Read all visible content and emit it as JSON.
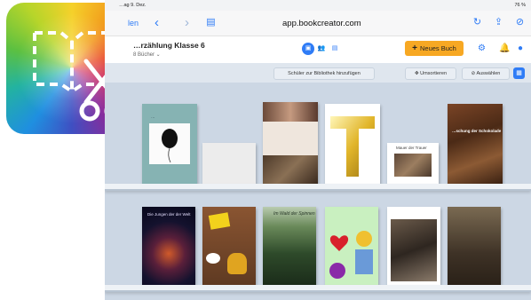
{
  "status": {
    "time": "…ag 9. Dez.",
    "battery": "76 %"
  },
  "browser": {
    "back_label": "len",
    "url": "app.bookcreator.com"
  },
  "app_header": {
    "library_title": "…rzählung Klasse 6",
    "library_subtitle": "8 Bücher ⌄",
    "new_book_label": "Neues Buch"
  },
  "toolbar": {
    "add_students_label": "Schüler zur Bibliothek hinzufügen",
    "sort_label": "Umsortieren",
    "select_label": "Auswählen"
  },
  "books": {
    "b1": {
      "title": "…"
    },
    "b2": {
      "title": ""
    },
    "b3": {
      "title": ""
    },
    "b4": {
      "title": ""
    },
    "b5": {
      "title": "Mauer der Trauer"
    },
    "b6": {
      "title": "…schung der Schokolade"
    },
    "b7": {
      "title": "Die Jungen der der Welt"
    },
    "b8": {
      "title": ""
    },
    "b9": {
      "title": "Im Wald der Spinnen"
    },
    "b10": {
      "title": ""
    },
    "b11": {
      "title": ""
    },
    "b12": {
      "title": ""
    }
  },
  "colors": {
    "accent": "#2f7cf6",
    "new_book": "#f7a823",
    "library_bg": "#ccd7e4"
  }
}
